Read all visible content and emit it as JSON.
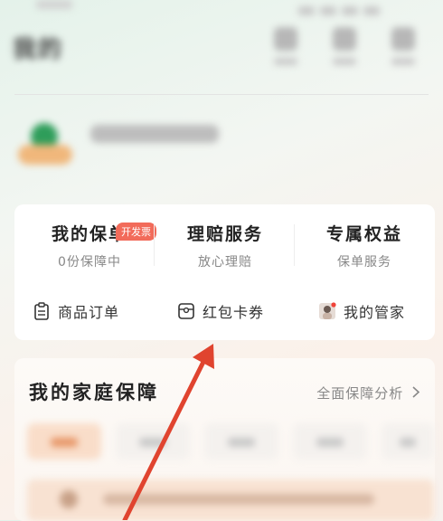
{
  "header": {
    "title": "我的"
  },
  "services": [
    {
      "title": "我的保单",
      "subtitle": "0份保障中",
      "badge": "开发票"
    },
    {
      "title": "理赔服务",
      "subtitle": "放心理赔"
    },
    {
      "title": "专属权益",
      "subtitle": "保单服务"
    }
  ],
  "links": [
    {
      "label": "商品订单",
      "icon": "clipboard-icon"
    },
    {
      "label": "红包卡券",
      "icon": "coupon-icon"
    },
    {
      "label": "我的管家",
      "icon": "butler-avatar-icon"
    }
  ],
  "family": {
    "title": "我的家庭保障",
    "link": "全面保障分析"
  },
  "colors": {
    "badge": "#f26b5a",
    "arrow": "#e0442f",
    "accent_tab": "#f9ddc9"
  }
}
